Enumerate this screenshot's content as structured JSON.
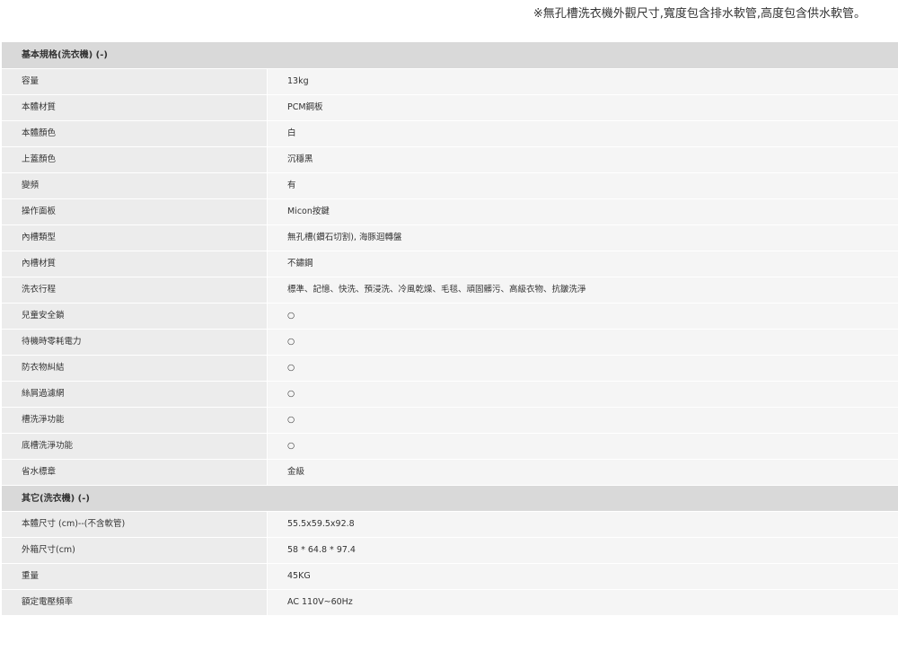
{
  "note": "※無孔槽洗衣機外觀尺寸,寬度包含排水軟管,高度包含供水軟管。",
  "sections": [
    {
      "title": "基本規格(洗衣機) (-)",
      "rows": [
        {
          "label": "容量",
          "value": "13kg"
        },
        {
          "label": "本體材質",
          "value": "PCM鋼板"
        },
        {
          "label": "本體顏色",
          "value": "白"
        },
        {
          "label": "上蓋顏色",
          "value": "沉穩黑"
        },
        {
          "label": "變頻",
          "value": "有"
        },
        {
          "label": "操作面板",
          "value": "Micon按鍵"
        },
        {
          "label": "內槽類型",
          "value": "無孔槽(鑽石切割), 海豚迴轉盤"
        },
        {
          "label": "內槽材質",
          "value": "不鏽鋼"
        },
        {
          "label": "洗衣行程",
          "value": "標準、記憶、快洗、預浸洗、冷風乾燥、毛毯、頑固髒污、高級衣物、抗皺洗淨"
        },
        {
          "label": "兒童安全鎖",
          "value": "○"
        },
        {
          "label": "待機時零耗電力",
          "value": "○"
        },
        {
          "label": "防衣物糾結",
          "value": "○"
        },
        {
          "label": "絲屑過濾網",
          "value": "○"
        },
        {
          "label": "槽洗淨功能",
          "value": "○"
        },
        {
          "label": "底槽洗淨功能",
          "value": "○"
        },
        {
          "label": "省水標章",
          "value": "金級"
        }
      ]
    },
    {
      "title": "其它(洗衣機) (-)",
      "rows": [
        {
          "label": "本體尺寸 (cm)--(不含軟管)",
          "value": "55.5x59.5x92.8"
        },
        {
          "label": "外箱尺寸(cm)",
          "value": "58 * 64.8 * 97.4"
        },
        {
          "label": "重量",
          "value": "45KG"
        },
        {
          "label": "額定電壓頻率",
          "value": "AC 110V~60Hz"
        }
      ]
    }
  ]
}
